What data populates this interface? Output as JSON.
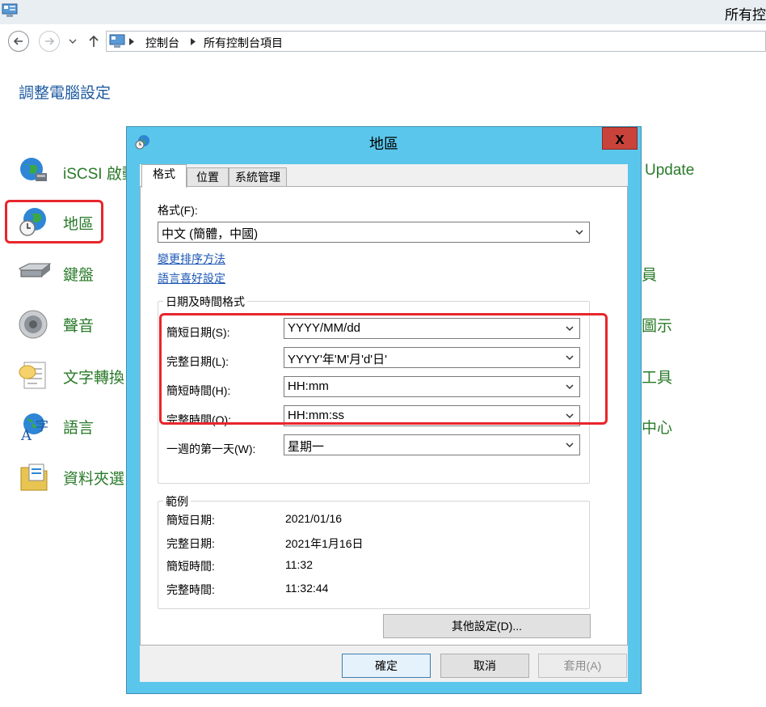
{
  "window": {
    "title": "所有控"
  },
  "nav": {
    "back_icon": "back-arrow-icon",
    "forward_icon": "forward-arrow-icon",
    "up_icon": "up-arrow-icon",
    "breadcrumb": [
      "控制台",
      "所有控制台項目"
    ]
  },
  "control_panel": {
    "heading": "調整電腦設定",
    "items_left": [
      {
        "label": "iSCSI 啟動",
        "icon": "iscsi-globe-icon"
      },
      {
        "label": "地區",
        "icon": "region-globe-clock-icon"
      },
      {
        "label": "鍵盤",
        "icon": "keyboard-icon"
      },
      {
        "label": "聲音",
        "icon": "speaker-icon"
      },
      {
        "label": "文字轉換",
        "icon": "speech-icon"
      },
      {
        "label": "語言",
        "icon": "language-icon"
      },
      {
        "label": "資料夾選",
        "icon": "folder-options-icon"
      }
    ],
    "items_right": [
      "Update",
      "員",
      "圖示",
      "工具",
      "中心"
    ]
  },
  "dialog": {
    "title": "地區",
    "close_label": "x",
    "tabs": [
      "格式",
      "位置",
      "系統管理"
    ],
    "format_label": "格式(F):",
    "format_value": "中文 (簡體，中國)",
    "link_sort": "變更排序方法",
    "link_lang": "語言喜好設定",
    "datetime_group": "日期及時間格式",
    "fields": [
      {
        "label": "簡短日期(S):",
        "value": "YYYY/MM/dd"
      },
      {
        "label": "完整日期(L):",
        "value": "YYYY'年'M'月'd'日'"
      },
      {
        "label": "簡短時間(H):",
        "value": "HH:mm"
      },
      {
        "label": "完整時間(O):",
        "value": "HH:mm:ss"
      },
      {
        "label": "一週的第一天(W):",
        "value": "星期一"
      }
    ],
    "examples_group": "範例",
    "examples": [
      {
        "label": "簡短日期:",
        "value": "2021/01/16"
      },
      {
        "label": "完整日期:",
        "value": "2021年1月16日"
      },
      {
        "label": "簡短時間:",
        "value": "11:32"
      },
      {
        "label": "完整時間:",
        "value": "11:32:44"
      }
    ],
    "other_settings": "其他設定(D)...",
    "ok": "確定",
    "cancel": "取消",
    "apply": "套用(A)"
  },
  "colors": {
    "highlight": "#e8262b",
    "dialog_frame": "#5bc6ec",
    "close": "#c9433a",
    "link": "#1a55b4"
  }
}
